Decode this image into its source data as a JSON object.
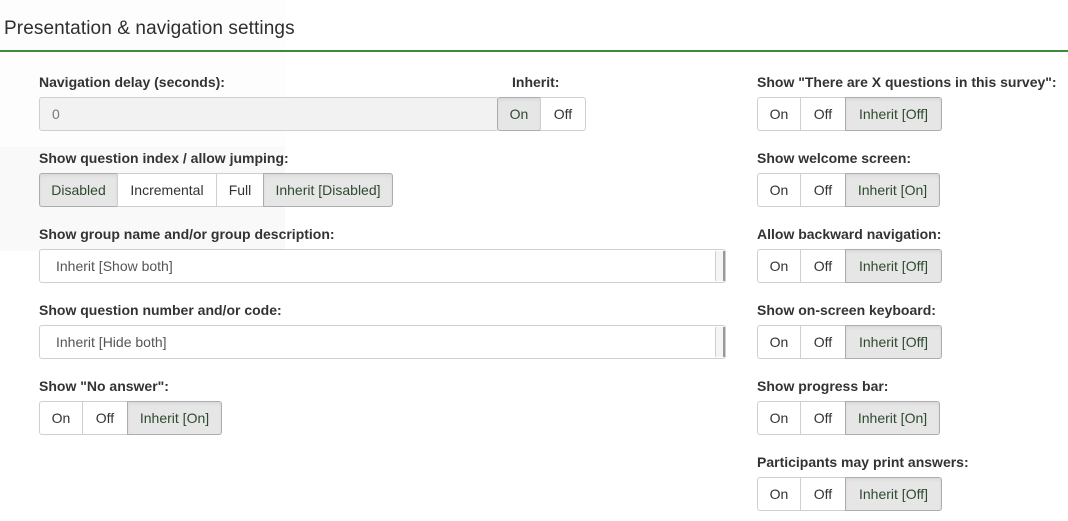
{
  "page": {
    "title": "Presentation & navigation settings"
  },
  "navigation_delay": {
    "label": "Navigation delay (seconds):",
    "value": "0"
  },
  "inherit": {
    "label": "Inherit:",
    "on": "On",
    "off": "Off"
  },
  "question_index": {
    "label": "Show question index / allow jumping:",
    "options": [
      "Disabled",
      "Incremental",
      "Full",
      "Inherit [Disabled]"
    ]
  },
  "group_name": {
    "label": "Show group name and/or group description:",
    "selected": "Inherit [Show both]"
  },
  "question_number": {
    "label": "Show question number and/or code:",
    "selected": "Inherit [Hide both]"
  },
  "no_answer": {
    "label": "Show \"No answer\":",
    "on": "On",
    "off": "Off",
    "inherit": "Inherit [On]"
  },
  "right": {
    "x_questions": {
      "label": "Show \"There are X questions in this survey\":",
      "on": "On",
      "off": "Off",
      "inherit": "Inherit [Off]"
    },
    "welcome": {
      "label": "Show welcome screen:",
      "on": "On",
      "off": "Off",
      "inherit": "Inherit [On]"
    },
    "backward": {
      "label": "Allow backward navigation:",
      "on": "On",
      "off": "Off",
      "inherit": "Inherit [Off]"
    },
    "keyboard": {
      "label": "Show on-screen keyboard:",
      "on": "On",
      "off": "Off",
      "inherit": "Inherit [Off]"
    },
    "progress": {
      "label": "Show progress bar:",
      "on": "On",
      "off": "Off",
      "inherit": "Inherit [On]"
    },
    "print": {
      "label": "Participants may print answers:",
      "on": "On",
      "off": "Off",
      "inherit": "Inherit [Off]"
    }
  }
}
